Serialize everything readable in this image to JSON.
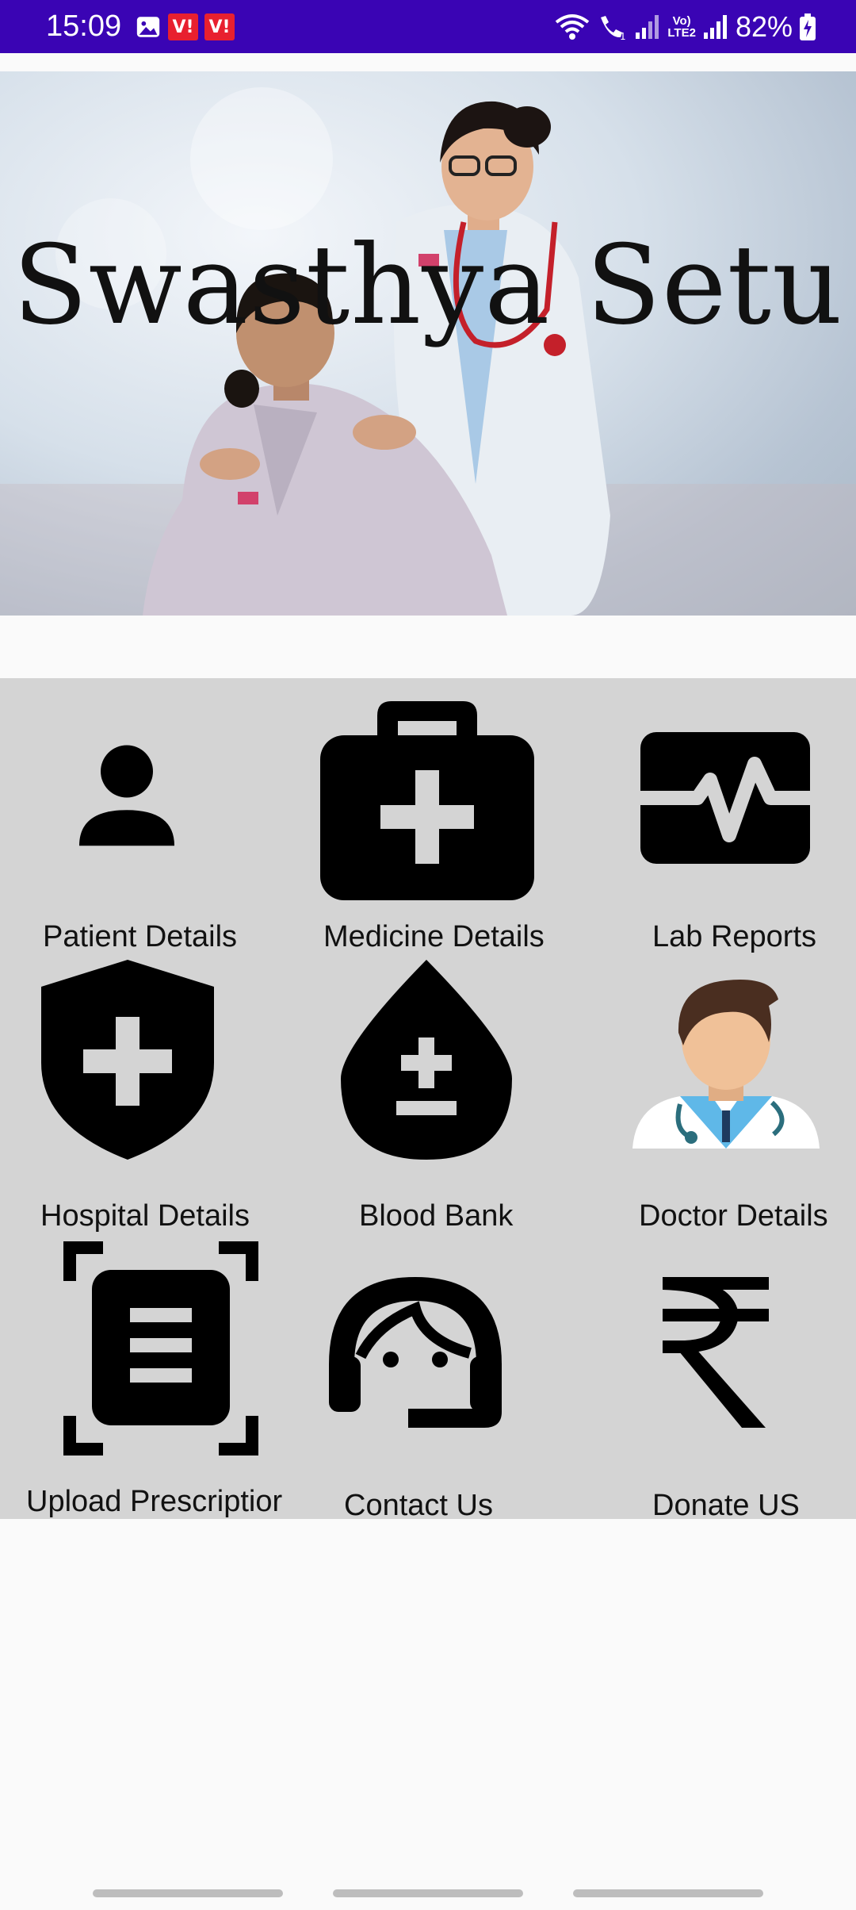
{
  "status_bar": {
    "time": "15:09",
    "battery": "82%",
    "volte_line1": "Vo)",
    "volte_line2": "LTE2",
    "bg_color": "#3a04b4"
  },
  "hero": {
    "title": "Swasthya Setu"
  },
  "menu": {
    "items": [
      {
        "label": "Patient Details",
        "icon": "person-icon"
      },
      {
        "label": "Medicine Details",
        "icon": "medical-bag-icon"
      },
      {
        "label": "Lab Reports",
        "icon": "monitor-heart-icon"
      },
      {
        "label": "Hospital Details",
        "icon": "shield-cross-icon"
      },
      {
        "label": "Blood Bank",
        "icon": "blood-drop-icon"
      },
      {
        "label": "Doctor Details",
        "icon": "doctor-avatar-icon"
      },
      {
        "label": "Upload Prescriptior",
        "icon": "document-scanner-icon"
      },
      {
        "label": "Contact Us",
        "icon": "support-agent-icon"
      },
      {
        "label": "Donate US",
        "icon": "rupee-icon"
      }
    ]
  },
  "colors": {
    "accent": "#3a04b4",
    "panel": "#d4d4d4",
    "background": "#fafafa"
  }
}
